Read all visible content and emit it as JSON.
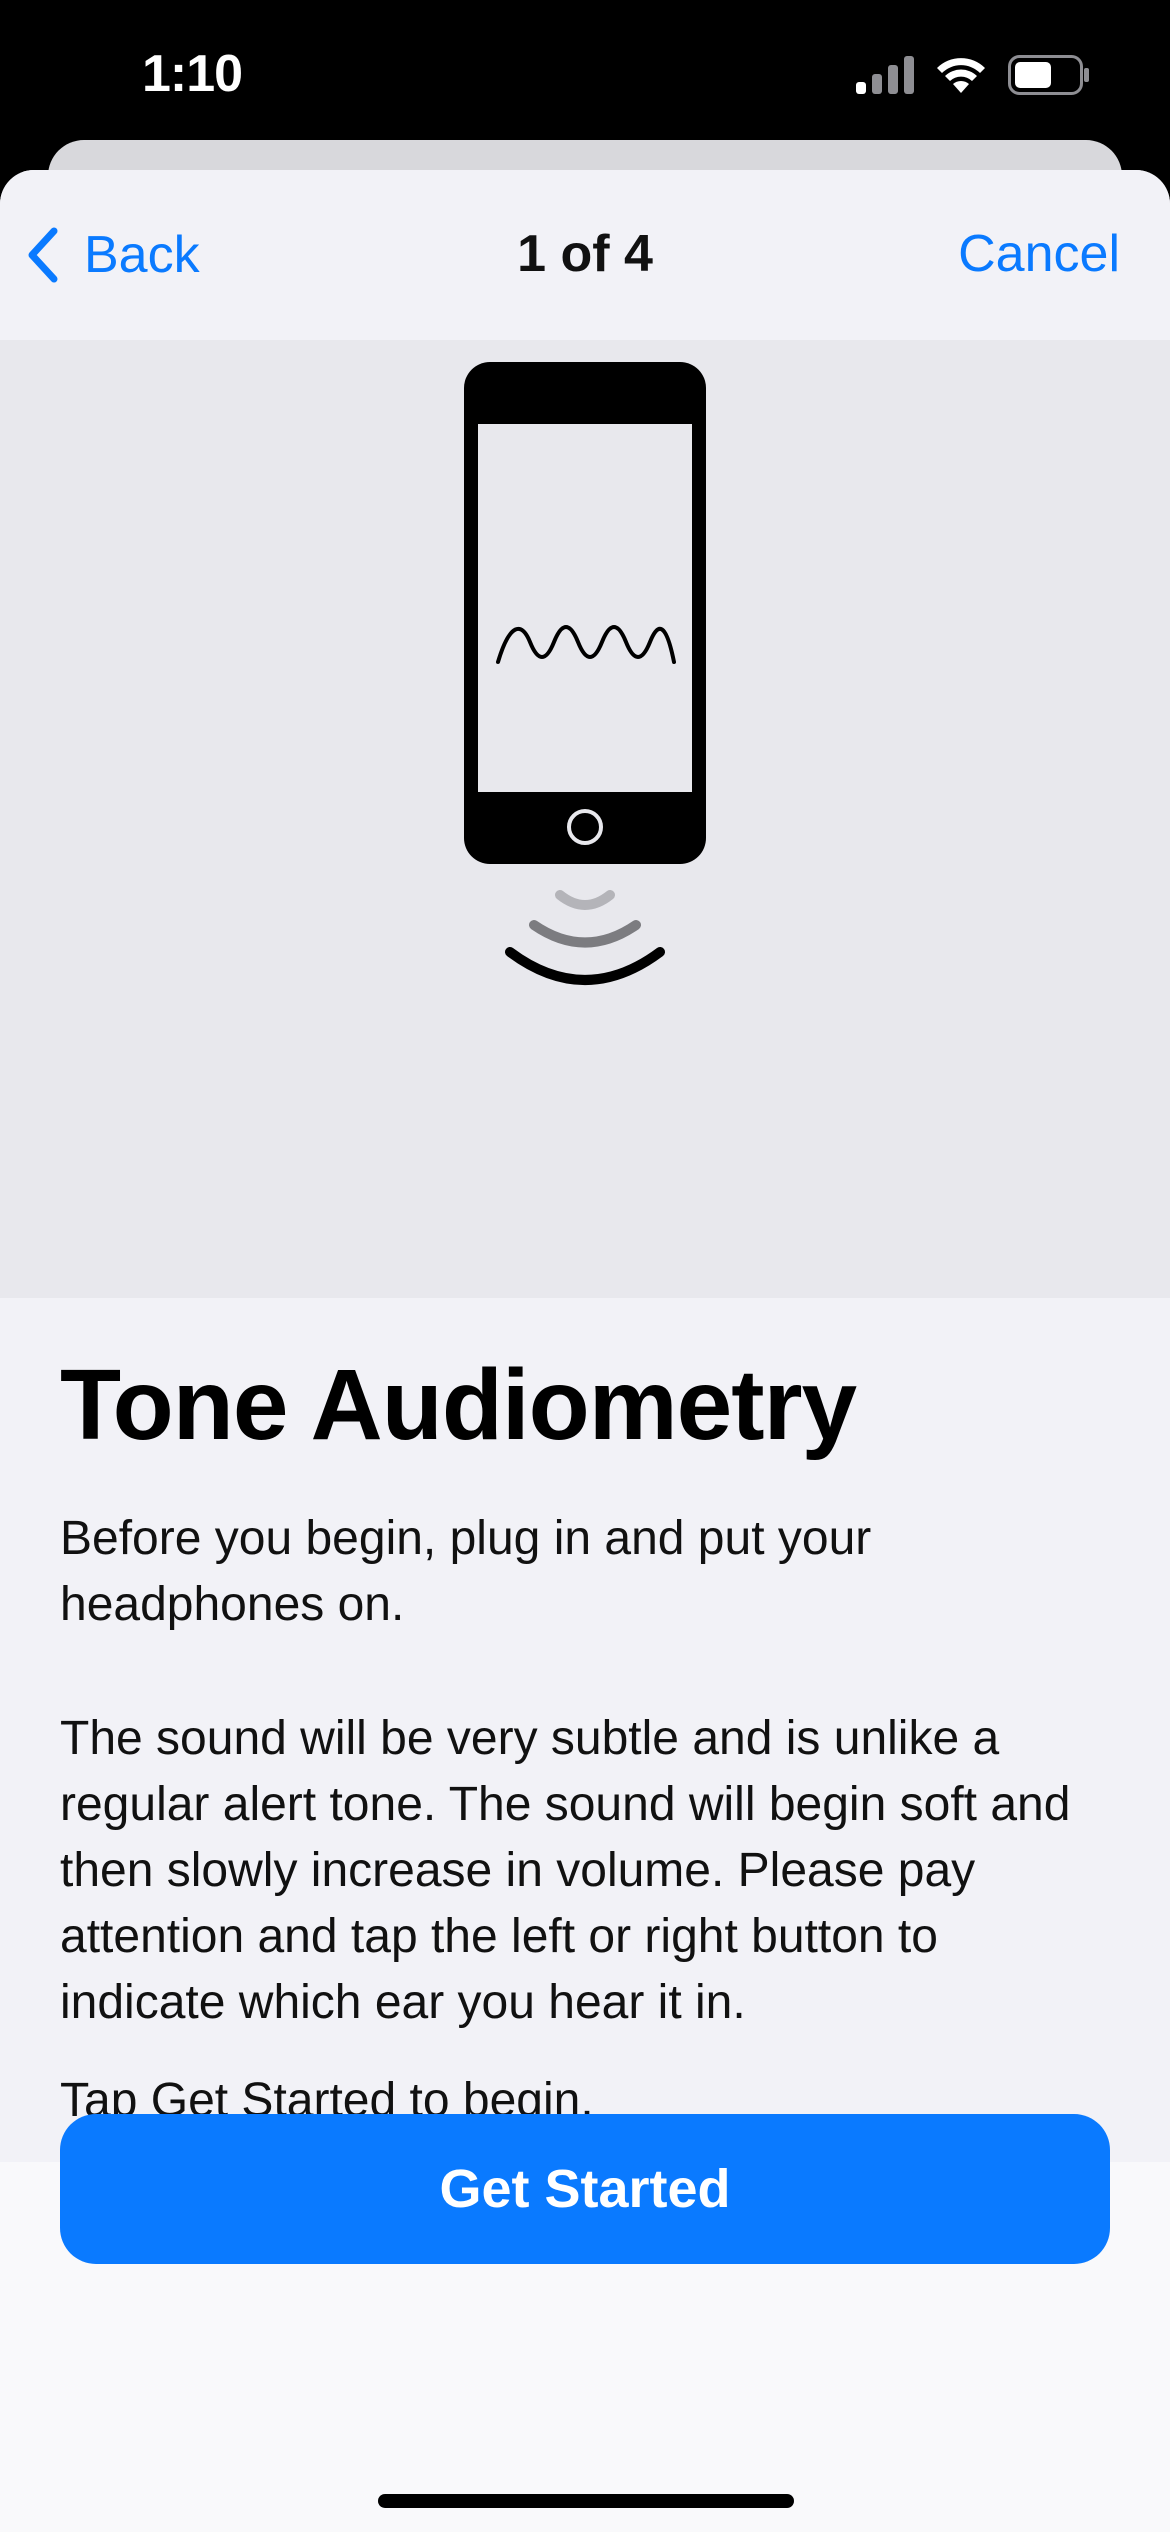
{
  "status_bar": {
    "time": "1:10",
    "icons": [
      "cellular-signal-icon",
      "wifi-icon",
      "battery-icon"
    ]
  },
  "nav": {
    "back_label": "Back",
    "title": "1 of 4",
    "cancel_label": "Cancel"
  },
  "hero": {
    "icon": "phone-sound-wave-illustration"
  },
  "content": {
    "title": "Tone Audiometry",
    "paragraph_1": "Before you begin, plug in and put your headphones on.",
    "paragraph_2": "The sound will be very subtle and is unlike a regular alert tone.  The sound will begin soft and then slowly increase in volume.  Please pay attention and tap the left or right button to indicate which ear you hear it in.",
    "paragraph_3": "Tap Get Started to begin."
  },
  "actions": {
    "get_started_label": "Get Started"
  },
  "colors": {
    "accent": "#0a7aff",
    "nav_background": "#f2f2f7",
    "hero_background": "#e8e8ed"
  }
}
